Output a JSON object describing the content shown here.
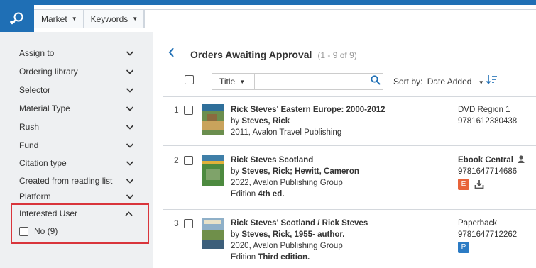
{
  "header": {
    "scope_label": "Market",
    "field_label": "Keywords"
  },
  "sidebar": {
    "facets": [
      {
        "label": "Assign to"
      },
      {
        "label": "Ordering library"
      },
      {
        "label": "Selector"
      },
      {
        "label": "Material Type"
      },
      {
        "label": "Rush"
      },
      {
        "label": "Fund"
      },
      {
        "label": "Citation type"
      },
      {
        "label": "Created from reading list"
      },
      {
        "label": "Platform"
      }
    ],
    "open_facet": {
      "label": "Interested User",
      "option_label": "No (9)"
    }
  },
  "main": {
    "title": "Orders Awaiting Approval",
    "count": "(1 - 9 of 9)",
    "search_field": "Title",
    "sort_label": "Sort by:",
    "sort_value": "Date Added"
  },
  "results": [
    {
      "num": "1",
      "title": "Rick Steves' Eastern Europe: 2000-2012",
      "by_prefix": "by ",
      "author": "Steves, Rick",
      "pub": "2011, Avalon Travel Publishing",
      "edition_prefix": "",
      "edition": "",
      "format": "DVD Region 1",
      "isbn": "9781612380438",
      "cover_colors": [
        "#6b8e4e",
        "#c9a35c",
        "#8a6a3e"
      ]
    },
    {
      "num": "2",
      "title": "Rick Steves Scotland",
      "by_prefix": "by ",
      "author": "Steves, Rick; Hewitt, Cameron",
      "pub": "2022, Avalon Publishing Group",
      "edition_prefix": "Edition ",
      "edition": "4th ed.",
      "format": "Ebook Central",
      "isbn": "9781647714686",
      "badge": "E",
      "badge_color": "#e8633a",
      "cover_colors": [
        "#3f7fa8",
        "#e0b13a",
        "#4d8a3f"
      ]
    },
    {
      "num": "3",
      "title": "Rick Steves' Scotland / Rick Steves",
      "by_prefix": "by ",
      "author": "Steves, Rick, 1955- author.",
      "pub": "2020, Avalon Publishing Group",
      "edition_prefix": "Edition ",
      "edition": "Third edition.",
      "format": "Paperback",
      "isbn": "9781647712262",
      "badge": "P",
      "badge_color": "#2b7bc4",
      "cover_colors": [
        "#8fb0c8",
        "#6f8f4a",
        "#3d5f7a"
      ]
    }
  ],
  "colors": {
    "brand": "#1f6fb5",
    "highlight_border": "#d9353b"
  }
}
